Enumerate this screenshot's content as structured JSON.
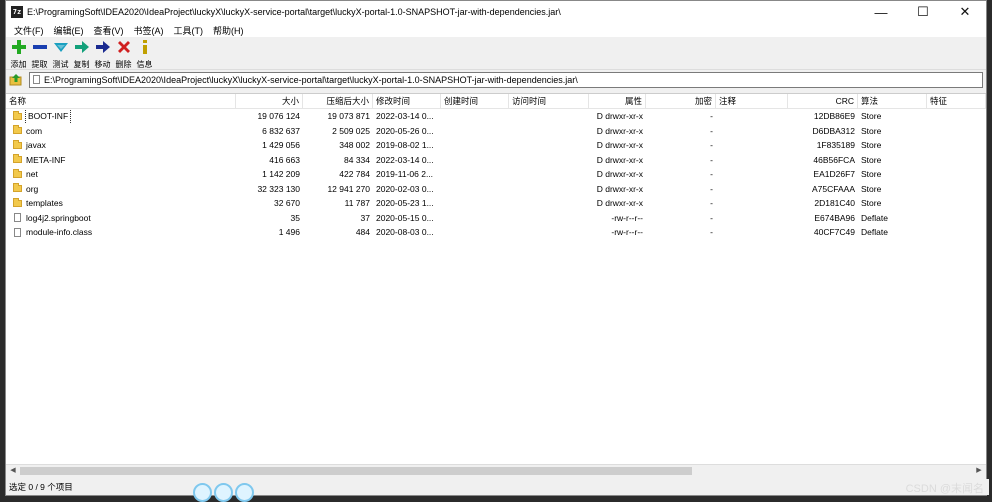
{
  "window": {
    "app_icon": "7z",
    "title": "E:\\ProgramingSoft\\IDEA2020\\IdeaProject\\luckyX\\luckyX-service-portal\\target\\luckyX-portal-1.0-SNAPSHOT-jar-with-dependencies.jar\\"
  },
  "menu": [
    "文件(F)",
    "编辑(E)",
    "查看(V)",
    "书签(A)",
    "工具(T)",
    "帮助(H)"
  ],
  "toolbar": [
    {
      "label": "添加",
      "icon": "add-icon",
      "color": "#22aa22"
    },
    {
      "label": "提取",
      "icon": "extract-icon",
      "color": "#1a3fb0"
    },
    {
      "label": "测试",
      "icon": "test-icon",
      "color": "#1aa0c0"
    },
    {
      "label": "复制",
      "icon": "copy-icon",
      "color": "#12a07a"
    },
    {
      "label": "移动",
      "icon": "move-icon",
      "color": "#1a2a90"
    },
    {
      "label": "删除",
      "icon": "delete-icon",
      "color": "#d02020"
    },
    {
      "label": "信息",
      "icon": "info-icon",
      "color": "#c0a000"
    }
  ],
  "address": "E:\\ProgramingSoft\\IDEA2020\\IdeaProject\\luckyX\\luckyX-service-portal\\target\\luckyX-portal-1.0-SNAPSHOT-jar-with-dependencies.jar\\",
  "columns": {
    "name": "名称",
    "size": "大小",
    "packed": "压缩后大小",
    "modified": "修改时间",
    "created": "创建时间",
    "accessed": "访问时间",
    "attributes": "属性",
    "encrypted": "加密",
    "comment": "注释",
    "crc": "CRC",
    "method": "算法",
    "characteristics": "特征"
  },
  "rows": [
    {
      "name": "BOOT-INF",
      "type": "folder",
      "size": "19 076 124",
      "packed": "19 073 871",
      "modified": "2022-03-14 0...",
      "attributes": "D drwxr-xr-x",
      "encrypted": "-",
      "crc": "12DB86E9",
      "method": "Store"
    },
    {
      "name": "com",
      "type": "folder",
      "size": "6 832 637",
      "packed": "2 509 025",
      "modified": "2020-05-26 0...",
      "attributes": "D drwxr-xr-x",
      "encrypted": "-",
      "crc": "D6DBA312",
      "method": "Store"
    },
    {
      "name": "javax",
      "type": "folder",
      "size": "1 429 056",
      "packed": "348 002",
      "modified": "2019-08-02 1...",
      "attributes": "D drwxr-xr-x",
      "encrypted": "-",
      "crc": "1F835189",
      "method": "Store"
    },
    {
      "name": "META-INF",
      "type": "folder",
      "size": "416 663",
      "packed": "84 334",
      "modified": "2022-03-14 0...",
      "attributes": "D drwxr-xr-x",
      "encrypted": "-",
      "crc": "46B56FCA",
      "method": "Store"
    },
    {
      "name": "net",
      "type": "folder",
      "size": "1 142 209",
      "packed": "422 784",
      "modified": "2019-11-06 2...",
      "attributes": "D drwxr-xr-x",
      "encrypted": "-",
      "crc": "EA1D26F7",
      "method": "Store"
    },
    {
      "name": "org",
      "type": "folder",
      "size": "32 323 130",
      "packed": "12 941 270",
      "modified": "2020-02-03 0...",
      "attributes": "D drwxr-xr-x",
      "encrypted": "-",
      "crc": "A75CFAAA",
      "method": "Store"
    },
    {
      "name": "templates",
      "type": "folder",
      "size": "32 670",
      "packed": "11 787",
      "modified": "2020-05-23 1...",
      "attributes": "D drwxr-xr-x",
      "encrypted": "-",
      "crc": "2D181C40",
      "method": "Store"
    },
    {
      "name": "log4j2.springboot",
      "type": "file",
      "size": "35",
      "packed": "37",
      "modified": "2020-05-15 0...",
      "attributes": "-rw-r--r--",
      "encrypted": "-",
      "crc": "E674BA96",
      "method": "Deflate"
    },
    {
      "name": "module-info.class",
      "type": "file",
      "size": "1 496",
      "packed": "484",
      "modified": "2020-08-03 0...",
      "attributes": "-rw-r--r--",
      "encrypted": "-",
      "crc": "40CF7C49",
      "method": "Deflate"
    }
  ],
  "status": "选定 0 / 9 个项目",
  "watermark": "CSDN @末闻名"
}
